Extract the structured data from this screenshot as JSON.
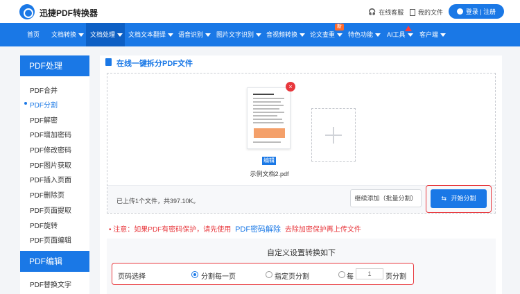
{
  "header": {
    "brand": "迅捷PDF转换器",
    "service": "在线客服",
    "my_files": "我的文件",
    "login": "登录 | 注册"
  },
  "nav": {
    "items": [
      {
        "label": "首页"
      },
      {
        "label": "文档转换"
      },
      {
        "label": "文档处理"
      },
      {
        "label": "文档文本翻译"
      },
      {
        "label": "语音识别"
      },
      {
        "label": "图片文字识别"
      },
      {
        "label": "音视频转换"
      },
      {
        "label": "论文查重"
      },
      {
        "label": "特色功能"
      },
      {
        "label": "AI工具"
      },
      {
        "label": "客户端"
      }
    ],
    "new_badge": "新",
    "active": "文档处理"
  },
  "sidebar": {
    "section1": "PDF处理",
    "items": [
      "PDF合并",
      "PDF分割",
      "PDF解密",
      "PDF增加密码",
      "PDF修改密码",
      "PDF图片获取",
      "PDF插入页面",
      "PDF删除页",
      "PDF页面提取",
      "PDF旋转",
      "PDF页面编辑"
    ],
    "active": "PDF分割",
    "section2": "PDF编辑",
    "items2": [
      "PDF替换文字"
    ]
  },
  "main": {
    "title": "在线一键拆分PDF文件",
    "file": {
      "name": "示例文档2.pdf",
      "edit": "编辑",
      "delete": "×"
    },
    "info": "已上传1个文件，共397.10K。",
    "continue_btn": "继续添加（批量分割）",
    "start_btn": "开始分割",
    "notice_prefix": "•  注意：如果PDF有密码保护，请先使用",
    "notice_link": "PDF密码解除",
    "notice_suffix": "去除加密保护再上传文件",
    "settings_title": "自定义设置转换如下",
    "page_select_label": "页码选择",
    "options": {
      "each": "分割每一页",
      "custom": "指定页分割",
      "every_prefix": "每",
      "every_value": "1",
      "every_suffix": "页分割"
    },
    "selected_option": "分割每一页"
  },
  "colors": {
    "accent": "#1a78e6",
    "nav_active": "#0d5fc4",
    "highlight": "#e8383d"
  }
}
